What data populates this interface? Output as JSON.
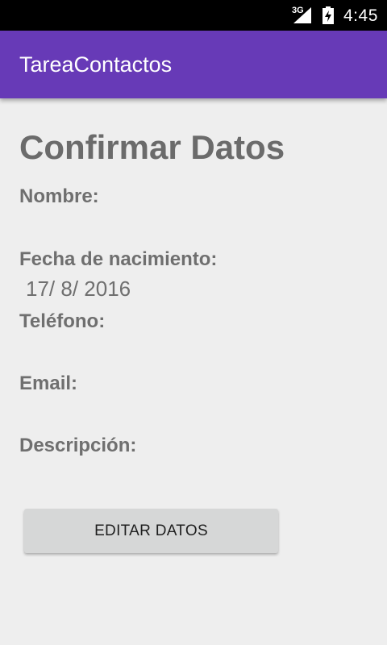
{
  "status_bar": {
    "network_type": "3G",
    "time": "4:45",
    "icons": [
      "signal-icon",
      "battery-icon"
    ]
  },
  "app_bar": {
    "title": "TareaContactos",
    "color": "#673ab7"
  },
  "main": {
    "page_title": "Confirmar Datos",
    "fields": [
      {
        "label": "Nombre:",
        "value": ""
      },
      {
        "label": "Fecha de nacimiento:",
        "value": "17/ 8/ 2016"
      },
      {
        "label": "Teléfono:",
        "value": ""
      },
      {
        "label": "Email:",
        "value": ""
      },
      {
        "label": "Descripción:",
        "value": ""
      }
    ],
    "edit_button_label": "EDITAR DATOS"
  }
}
